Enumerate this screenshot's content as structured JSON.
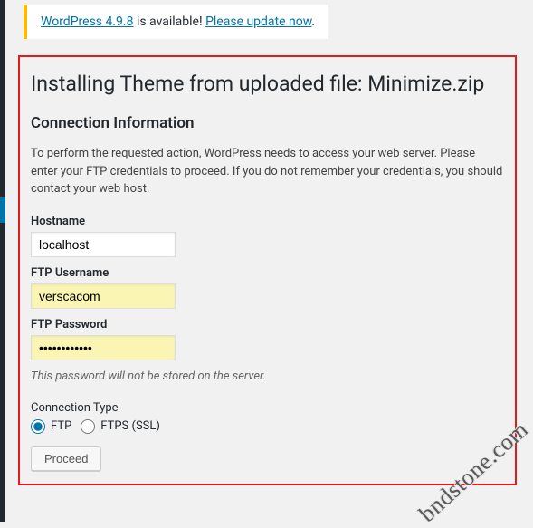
{
  "update_nag": {
    "link1_text": "WordPress 4.9.8",
    "mid_text": " is available! ",
    "link2_text": "Please update now",
    "period": "."
  },
  "heading": "Installing Theme from uploaded file: Minimize.zip",
  "subheading": "Connection Information",
  "intro": "To perform the requested action, WordPress needs to access your web server. Please enter your FTP credentials to proceed. If you do not remember your credentials, you should contact your web host.",
  "fields": {
    "hostname": {
      "label": "Hostname",
      "value": "localhost"
    },
    "ftp_user": {
      "label": "FTP Username",
      "value": "verscacom"
    },
    "ftp_pass": {
      "label": "FTP Password",
      "value": "••••••••••••"
    },
    "pass_hint": "This password will not be stored on the server."
  },
  "connection_type": {
    "label": "Connection Type",
    "options": {
      "ftp": "FTP",
      "ftps": "FTPS (SSL)"
    }
  },
  "proceed_label": "Proceed",
  "watermark": "bndstone.com"
}
